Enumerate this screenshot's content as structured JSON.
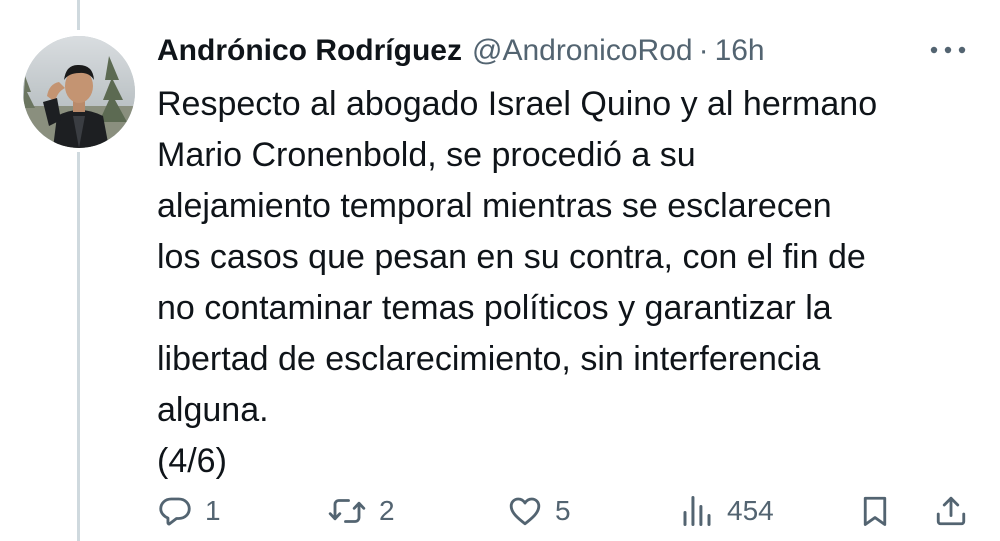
{
  "tweet": {
    "author": {
      "display_name": "Andrónico Rodríguez",
      "handle": "@AndronicoRod"
    },
    "separator": "·",
    "time": "16h",
    "text": "Respecto al abogado Israel Quino y al hermano\nMario Cronenbold, se procedió a su\nalejamiento temporal mientras se esclarecen\nlos casos que pesan en su contra, con el fin de\nno contaminar temas políticos y garantizar la\nlibertad de esclarecimiento, sin interferencia\nalguna.\n(4/6)",
    "actions": {
      "reply_count": "1",
      "retweet_count": "2",
      "like_count": "5",
      "views_count": "454"
    }
  },
  "icons": {
    "more": "more-dots-icon",
    "reply": "reply-bubble-icon",
    "retweet": "retweet-arrows-icon",
    "like": "heart-icon",
    "views": "bar-chart-icon",
    "bookmark": "bookmark-icon",
    "share": "share-upload-icon"
  },
  "colors": {
    "text_primary": "#0f1419",
    "text_secondary": "#536471",
    "thread_line": "#cfd9de"
  }
}
